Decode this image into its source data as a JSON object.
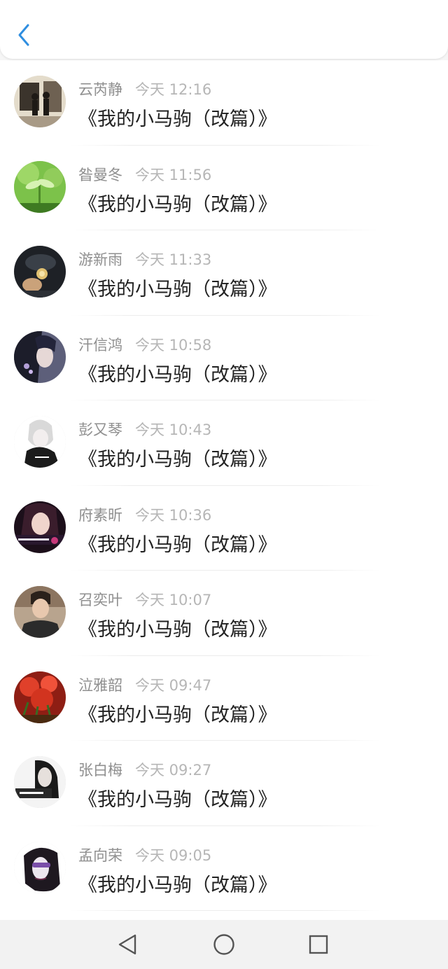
{
  "header": {
    "back_icon": "chevron-left-icon",
    "accent": "#2f8ee0"
  },
  "list": {
    "items": [
      {
        "name": "云芮静",
        "time": "今天 12:16",
        "title": "《我的小马驹（改篇）》",
        "avatar": "avatar-photo-icon"
      },
      {
        "name": "昝曼冬",
        "time": "今天 11:56",
        "title": "《我的小马驹（改篇）》",
        "avatar": "avatar-photo-icon"
      },
      {
        "name": "游新雨",
        "time": "今天 11:33",
        "title": "《我的小马驹（改篇）》",
        "avatar": "avatar-photo-icon"
      },
      {
        "name": "汗信鸿",
        "time": "今天 10:58",
        "title": "《我的小马驹（改篇）》",
        "avatar": "avatar-photo-icon"
      },
      {
        "name": "彭又琴",
        "time": "今天 10:43",
        "title": "《我的小马驹（改篇）》",
        "avatar": "avatar-photo-icon"
      },
      {
        "name": "府素昕",
        "time": "今天 10:36",
        "title": "《我的小马驹（改篇）》",
        "avatar": "avatar-photo-icon"
      },
      {
        "name": "召奕叶",
        "time": "今天 10:07",
        "title": "《我的小马驹（改篇）》",
        "avatar": "avatar-photo-icon"
      },
      {
        "name": "泣雅韶",
        "time": "今天 09:47",
        "title": "《我的小马驹（改篇）》",
        "avatar": "avatar-photo-icon"
      },
      {
        "name": "张白梅",
        "time": "今天 09:27",
        "title": "《我的小马驹（改篇）》",
        "avatar": "avatar-photo-icon"
      },
      {
        "name": "孟向荣",
        "time": "今天 09:05",
        "title": "《我的小马驹（改篇）》",
        "avatar": "avatar-photo-icon"
      }
    ]
  },
  "navbar": {
    "back_icon": "triangle-back-icon",
    "home_icon": "circle-home-icon",
    "recents_icon": "square-recents-icon"
  }
}
